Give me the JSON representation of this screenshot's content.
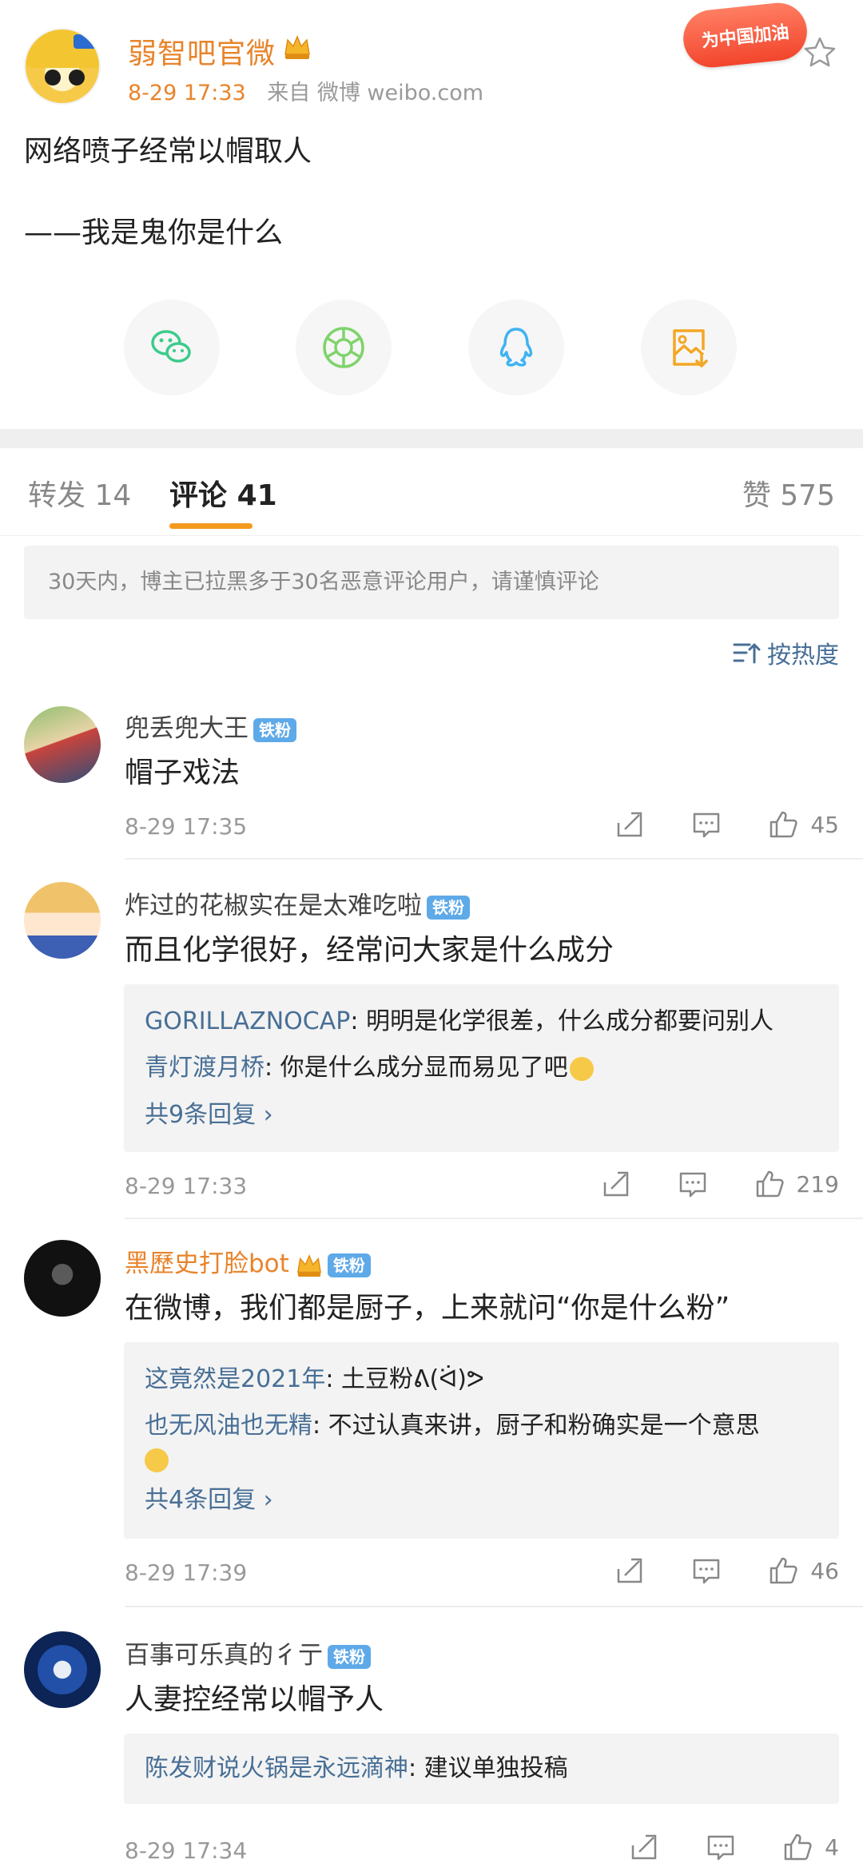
{
  "post": {
    "author": "弱智吧官微",
    "time": "8-29 17:33",
    "source": "来自 微博 weibo.com",
    "promo_badge": "为中国加油",
    "text_line1": "网络喷子经常以帽取人",
    "text_line2": "——我是鬼你是什么"
  },
  "share": {
    "icons": [
      "wechat-icon",
      "moments-icon",
      "qq-icon",
      "save-image-icon"
    ],
    "colors": {
      "wechat": "#3ccb8c",
      "moments": "#7fd36b",
      "qq": "#3fb3f1",
      "save": "#f4a623"
    }
  },
  "tabs": {
    "repost_label": "转发",
    "repost_count": "14",
    "comment_label": "评论",
    "comment_count": "41",
    "like_label": "赞",
    "like_count": "575"
  },
  "notice": "30天内，博主已拉黑多于30名恶意评论用户，请谨慎评论",
  "sort_label": "按热度",
  "fan_badge": "铁粉",
  "colors": {
    "accent": "#f49a1e",
    "link": "#486f96",
    "orange_name": "#e8842b",
    "fan_badge": "#5ea9e8"
  },
  "comments": [
    {
      "name": "兜丢兜大王",
      "text": "帽子戏法",
      "time": "8-29 17:35",
      "likes": "45",
      "replies": []
    },
    {
      "name": "炸过的花椒实在是太难吃啦",
      "text": "而且化学很好，经常问大家是什么成分",
      "time": "8-29 17:33",
      "likes": "219",
      "replies": [
        {
          "user": "GORILLAZNOCAP",
          "text": ": 明明是化学很差，什么成分都要问别人"
        },
        {
          "user": "青灯渡月桥",
          "text": ": 你是什么成分显而易见了吧"
        }
      ],
      "more": "共9条回复 ›"
    },
    {
      "name": "黑歷史打脸bot",
      "text": "在微博，我们都是厨子，上来就问“你是什么粉”",
      "time": "8-29 17:39",
      "likes": "46",
      "replies": [
        {
          "user": "这竟然是2021年",
          "text": ": 土豆粉ᕕ(ᐛ)ᕗ"
        },
        {
          "user": "也无风油也无精",
          "text": ": 不过认真来讲，厨子和粉确实是一个意思"
        }
      ],
      "more": "共4条回复 ›"
    },
    {
      "name": "百事可乐真的彳亍",
      "text": "人妻控经常以帽予人",
      "time": "8-29 17:34",
      "likes": "4",
      "replies": [
        {
          "user": "陈发财说火锅是永远滴神",
          "text": ": 建议单独投稿"
        }
      ]
    }
  ]
}
